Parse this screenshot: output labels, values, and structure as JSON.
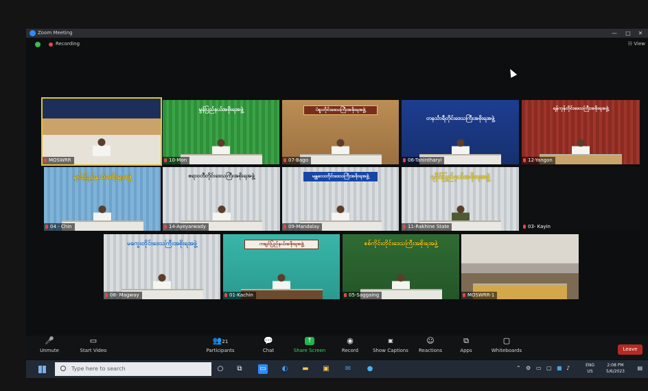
{
  "window": {
    "title": "Zoom Meeting",
    "recording_label": "Recording",
    "view_label": "View",
    "minimize": "—",
    "maximize": "□",
    "close": "✕"
  },
  "participants": [
    {
      "name": "MOSWRR",
      "banner": "",
      "active": true
    },
    {
      "name": "10-Mon",
      "banner": "မွန်ပြည်နယ်အစိုးရအဖွဲ့"
    },
    {
      "name": "07-Bago",
      "banner": "ပဲခူးတိုင်းဒေသကြီးအစိုးရအဖွဲ့"
    },
    {
      "name": "06-Tanintharyi",
      "banner": "တနင်္သာရီတိုင်းဒေသကြီးအစိုးရအဖွဲ့"
    },
    {
      "name": "12-Yangon",
      "banner": "ရန်ကုန်တိုင်းဒေသကြီးအစိုးရအဖွဲ့"
    },
    {
      "name": "04 - Chin",
      "banner": "ချင်းပြည်နယ်အစိုးရအဖွဲ့"
    },
    {
      "name": "14-Ayeyarwady",
      "banner": "ဧရာဝတီတိုင်းဒေသကြီးအစိုးရအဖွဲ့"
    },
    {
      "name": "09-Mandalay",
      "banner": "မန္တလေးတိုင်းဒေသကြီးအစိုးရအဖွဲ့"
    },
    {
      "name": "11-Rakhine State",
      "banner": "ရခိုင်ပြည်နယ်အစိုးရအဖွဲ့"
    },
    {
      "name": "03- Kayin",
      "banner": ""
    },
    {
      "name": "08- Magway",
      "banner": "မကွေးတိုင်းဒေသကြီးအစိုးရအဖွဲ့"
    },
    {
      "name": "01-Kachin",
      "banner": "ကချင်ပြည်နယ်အစိုးရအဖွဲ့"
    },
    {
      "name": "05-Saggaing",
      "banner": "စစ်ကိုင်းတိုင်းဒေသကြီးအစိုးရအဖွဲ့"
    },
    {
      "name": "MOSWRR-1",
      "banner": ""
    }
  ],
  "toolbar": {
    "unmute": "Unmute",
    "start_video": "Start Video",
    "participants": "Participants",
    "participants_count": "21",
    "chat": "Chat",
    "share_screen": "Share Screen",
    "record": "Record",
    "show_captions": "Show Captions",
    "reactions": "Reactions",
    "apps": "Apps",
    "whiteboards": "Whiteboards",
    "leave": "Leave"
  },
  "taskbar": {
    "search_placeholder": "Type here to search",
    "lang_top": "ENG",
    "lang_bottom": "US",
    "time": "2:08 PM",
    "date": "5/6/2023"
  },
  "icons": {
    "accent": "#2d8cff",
    "record_color": "#e5484d",
    "share_color": "#23b34f",
    "leave_color": "#b52a25"
  }
}
